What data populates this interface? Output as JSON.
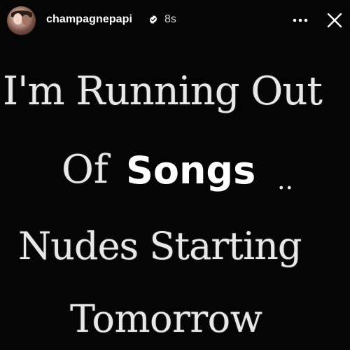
{
  "header": {
    "username": "champagnepapi",
    "timestamp": "8s",
    "verified_icon": "verified-badge-icon",
    "more_icon": "more-options-icon",
    "close_icon": "close-icon"
  },
  "story": {
    "line1": "I'm Running Out",
    "line2_prefix": "Of",
    "line2_sticker": "Songs",
    "line2_suffix": "..",
    "line3": "Nudes Starting",
    "line4": "Tomorrow"
  },
  "colors": {
    "background": "#050505",
    "text": "#e8e8e8",
    "sticker_text": "#ffffff",
    "timestamp": "#d6d6d6"
  }
}
